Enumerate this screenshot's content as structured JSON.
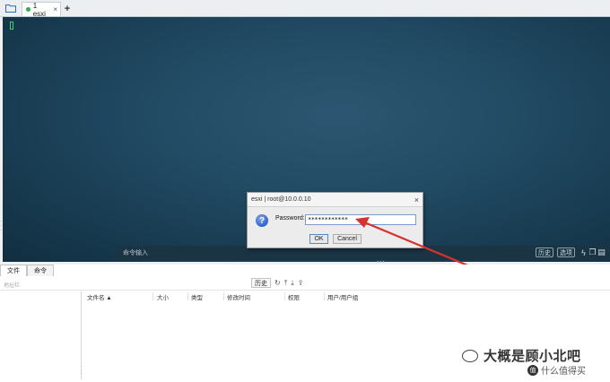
{
  "tabbar": {
    "tab_label": "1 esxi",
    "tab_close": "×",
    "add_label": "+"
  },
  "terminal": {
    "cmd_placeholder": "命令输入",
    "btn_history": "历史",
    "btn_options": "选项",
    "icons": [
      "bolt-icon",
      "copy-icon",
      "paste-icon",
      "menu-icon"
    ]
  },
  "dialog": {
    "title": "esxi | root@10.0.0.10",
    "close": "×",
    "password_label": "Password:",
    "password_value": "************",
    "ok_label": "OK",
    "cancel_label": "Cancel"
  },
  "bottom": {
    "tabs": [
      {
        "label": "文件"
      },
      {
        "label": "命令"
      }
    ],
    "address_placeholder": "地址栏",
    "history_label": "历史",
    "columns": [
      {
        "label": "文件名 ▲"
      },
      {
        "label": "大小"
      },
      {
        "label": "类型"
      },
      {
        "label": "修改时间"
      },
      {
        "label": "权限"
      },
      {
        "label": "用户/用户组"
      }
    ]
  },
  "watermark": {
    "text": "大概是顾小北吧",
    "site": "什么值得买",
    "badge": "值"
  },
  "colors": {
    "terminal_bg": "#214a63",
    "cursor": "#3fd46b",
    "arrow": "#d9312f"
  }
}
